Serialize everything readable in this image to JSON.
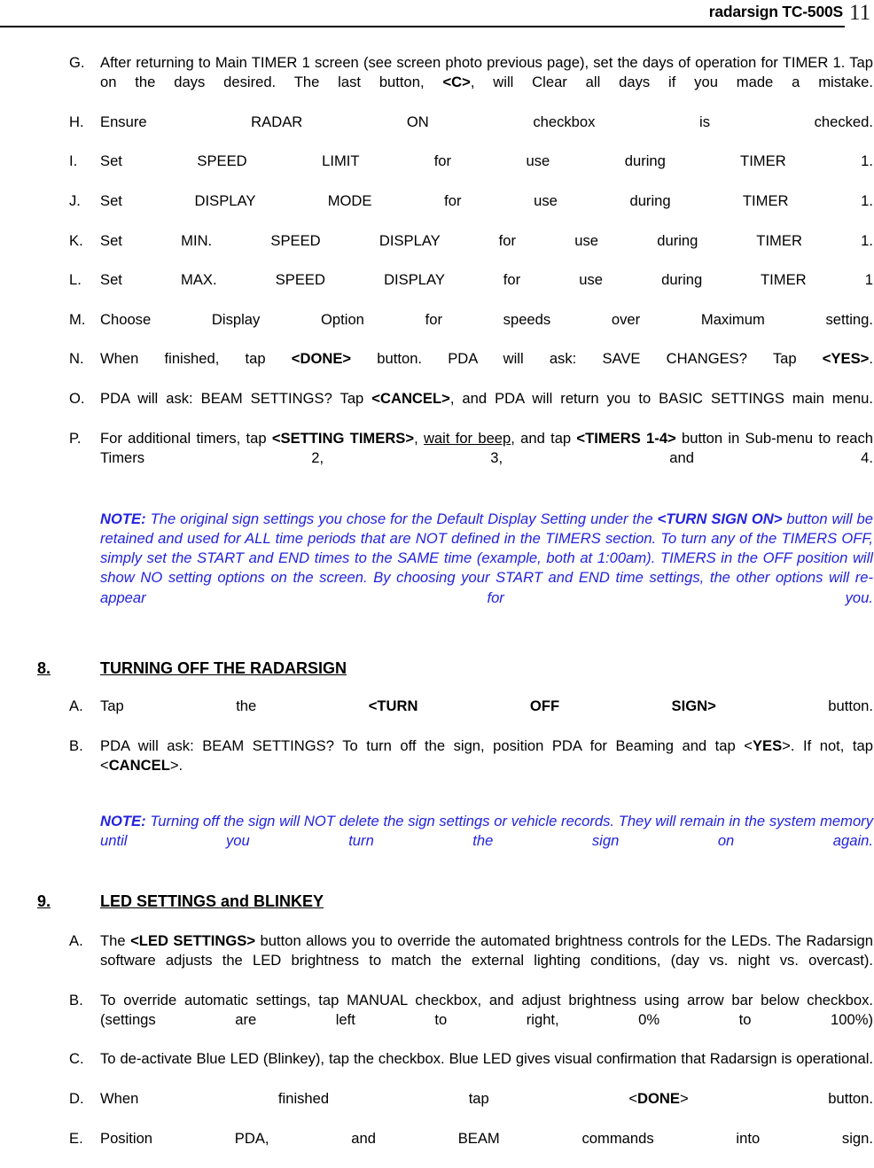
{
  "header": {
    "brand": "radarsign TC-500S",
    "page_number": "11"
  },
  "timer_steps": {
    "items": [
      {
        "marker": "G.",
        "segments": [
          {
            "t": "After returning to Main TIMER 1 screen (see screen photo previous page), set the days of operation for TIMER 1.  Tap on the days desired.  The last button, ",
            "style": "normal"
          },
          {
            "t": "<C>",
            "style": "bold"
          },
          {
            "t": ", will Clear all days if you made a mistake.",
            "style": "normal"
          }
        ]
      },
      {
        "marker": "H.",
        "segments": [
          {
            "t": "Ensure RADAR ON checkbox is checked.",
            "style": "normal"
          }
        ]
      },
      {
        "marker": "I.",
        "segments": [
          {
            "t": "Set SPEED LIMIT for use during TIMER 1.",
            "style": "normal"
          }
        ]
      },
      {
        "marker": "J.",
        "segments": [
          {
            "t": "Set DISPLAY MODE for use during TIMER 1.",
            "style": "normal"
          }
        ]
      },
      {
        "marker": "K.",
        "segments": [
          {
            "t": "Set MIN. SPEED DISPLAY for use during TIMER 1.",
            "style": "normal"
          }
        ]
      },
      {
        "marker": "L.",
        "segments": [
          {
            "t": "Set MAX. SPEED DISPLAY for use during TIMER 1",
            "style": "normal"
          }
        ]
      },
      {
        "marker": "M.",
        "segments": [
          {
            "t": "Choose Display Option for speeds over Maximum setting.",
            "style": "normal"
          }
        ]
      },
      {
        "marker": "N.",
        "segments": [
          {
            "t": "When finished, tap ",
            "style": "normal"
          },
          {
            "t": "<DONE>",
            "style": "bold"
          },
          {
            "t": " button.  PDA will ask: SAVE CHANGES? Tap ",
            "style": "normal"
          },
          {
            "t": "<YES>",
            "style": "bold"
          },
          {
            "t": ".",
            "style": "normal"
          }
        ]
      },
      {
        "marker": "O.",
        "segments": [
          {
            "t": "PDA will ask: BEAM SETTINGS?  Tap ",
            "style": "normal"
          },
          {
            "t": "<CANCEL>",
            "style": "bold"
          },
          {
            "t": ", and PDA will return you to BASIC SETTINGS main menu.",
            "style": "normal"
          }
        ]
      },
      {
        "marker": "P.",
        "segments": [
          {
            "t": "For additional timers, tap ",
            "style": "normal"
          },
          {
            "t": "<SETTING TIMERS>",
            "style": "bold"
          },
          {
            "t": ", ",
            "style": "normal"
          },
          {
            "t": "wait for beep",
            "style": "underline"
          },
          {
            "t": ", and tap ",
            "style": "normal"
          },
          {
            "t": "<TIMERS 1-4>",
            "style": "bold"
          },
          {
            "t": " button in Sub-menu to reach Timers 2, 3, and 4.",
            "style": "normal"
          }
        ]
      }
    ]
  },
  "note_timers": {
    "label": "NOTE:",
    "segments": [
      {
        "t": "  The original sign settings you chose for the Default Display Setting under the ",
        "style": "normal"
      },
      {
        "t": "<TURN SIGN ON>",
        "style": "bold"
      },
      {
        "t": " button will be retained and used for ALL time periods that are NOT defined in the TIMERS section.  To turn any of the TIMERS OFF, simply set the START and END times to the SAME time (example, both at 1:00am).  TIMERS in the OFF position will show NO setting options on the screen.  By choosing your START and END time settings, the other options will re-appear for you.",
        "style": "normal"
      }
    ]
  },
  "section8": {
    "number": "8.",
    "title": "TURNING OFF THE RADARSIGN",
    "items": [
      {
        "marker": "A.",
        "segments": [
          {
            "t": "Tap the ",
            "style": "normal"
          },
          {
            "t": "<TURN OFF SIGN>",
            "style": "bold"
          },
          {
            "t": " button.",
            "style": "normal"
          }
        ]
      },
      {
        "marker": "B.",
        "segments": [
          {
            "t": "PDA will ask: BEAM SETTINGS?  To turn off the sign, position PDA for Beaming and tap <",
            "style": "normal"
          },
          {
            "t": "YES",
            "style": "bold"
          },
          {
            "t": ">.  If not, tap <",
            "style": "normal"
          },
          {
            "t": "CANCEL",
            "style": "bold"
          },
          {
            "t": ">.",
            "style": "normal"
          }
        ]
      }
    ]
  },
  "note_turnoff": {
    "label": "NOTE:",
    "segments": [
      {
        "t": "  Turning off the sign will NOT delete the sign settings or vehicle records.  They will remain in the system memory until you turn the sign on again.",
        "style": "normal"
      }
    ]
  },
  "section9": {
    "number": "9.",
    "title": "LED SETTINGS and BLINKEY",
    "items": [
      {
        "marker": "A.",
        "segments": [
          {
            "t": "The ",
            "style": "normal"
          },
          {
            "t": "<LED SETTINGS>",
            "style": "bold"
          },
          {
            "t": " button allows you to override the automated brightness controls for the LEDs.  The Radarsign software adjusts the LED brightness to match the external lighting conditions, (day vs. night vs. overcast).",
            "style": "normal"
          }
        ]
      },
      {
        "marker": "B.",
        "segments": [
          {
            "t": "To override automatic settings, tap MANUAL checkbox, and adjust brightness using arrow bar below checkbox.  (settings are left to right, 0% to 100%)",
            "style": "normal"
          }
        ]
      },
      {
        "marker": "C.",
        "segments": [
          {
            "t": "To de-activate Blue LED (Blinkey), tap the checkbox.   Blue LED gives visual confirmation that Radarsign is operational.",
            "style": "normal"
          }
        ]
      },
      {
        "marker": "D.",
        "segments": [
          {
            "t": "When finished tap <",
            "style": "normal"
          },
          {
            "t": "DONE",
            "style": "bold"
          },
          {
            "t": "> button.",
            "style": "normal"
          }
        ]
      },
      {
        "marker": "E.",
        "segments": [
          {
            "t": "Position PDA, and BEAM commands into sign.",
            "style": "normal"
          }
        ]
      }
    ]
  },
  "colors": {
    "note_blue": "#2323dd",
    "text_black": "#000000"
  }
}
